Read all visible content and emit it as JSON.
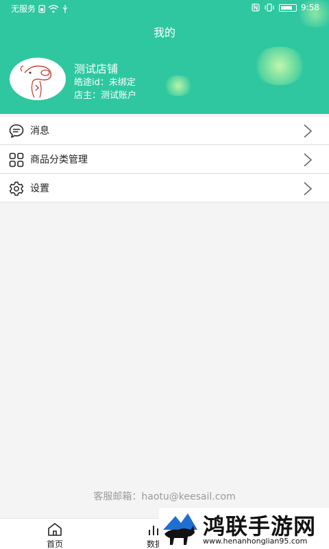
{
  "status_bar": {
    "carrier": "无服务",
    "time": "9:58"
  },
  "header": {
    "title": "我的"
  },
  "profile": {
    "shop_name": "测试店铺",
    "haotu_id": "皓途id：未绑定",
    "owner": "店主：测试账户"
  },
  "menu": {
    "items": [
      {
        "label": "消息",
        "icon": "chat-bubble-icon"
      },
      {
        "label": "商品分类管理",
        "icon": "grid-four-icon"
      },
      {
        "label": "设置",
        "icon": "gear-icon"
      }
    ]
  },
  "footer": {
    "contact": "客服邮箱：haotu@keesail.com"
  },
  "tabbar": {
    "tabs": [
      {
        "label": "首页",
        "icon": "home-icon"
      },
      {
        "label": "数据",
        "icon": "chart-icon"
      }
    ]
  },
  "watermark": {
    "title": "鸿联手游网",
    "url": "www.henanhonglian95.com"
  },
  "colors": {
    "header_bg": "#2ec7a0",
    "page_bg": "#f4f4f4",
    "text": "#222222",
    "muted": "#9a9a9a"
  }
}
